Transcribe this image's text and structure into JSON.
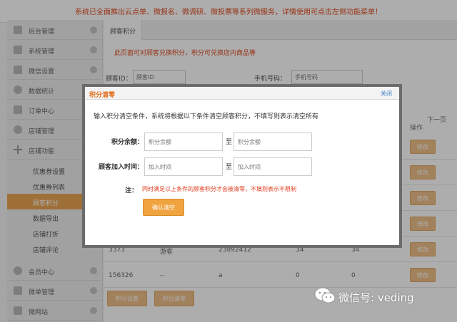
{
  "top_notice": "系统已全面推出云点单、微报名、微调研、微投票等系列微服务，详情使用可点击左侧功能菜单！",
  "sidebar": {
    "items": [
      {
        "label": "后台管理"
      },
      {
        "label": "系统管理"
      },
      {
        "label": "微信设置"
      },
      {
        "label": "数据统计"
      },
      {
        "label": "订单中心"
      },
      {
        "label": "店铺管理"
      },
      {
        "label": "店铺功能"
      }
    ],
    "subitems": [
      {
        "label": "优惠券设置"
      },
      {
        "label": "优惠券列表"
      },
      {
        "label": "顾客积分"
      },
      {
        "label": "数据导出"
      },
      {
        "label": "店铺打折"
      },
      {
        "label": "店铺评论"
      }
    ],
    "bottom_items": [
      {
        "label": "会员中心"
      },
      {
        "label": "微单管理"
      },
      {
        "label": "微网站"
      }
    ]
  },
  "main": {
    "tab_label": "顾客积分",
    "hint": "此页面可对顾客兑换积分，积分可兑换店内商品等",
    "filters": {
      "customer_id_label": "顾客ID：",
      "customer_id_placeholder": "顾客ID",
      "phone_label": "手机号码：",
      "phone_placeholder": "手机号码"
    },
    "next_label": "下一页",
    "col_operation": "操作",
    "edit_label": "修改",
    "rows": [
      {
        "id": "3373",
        "name": "游客",
        "phone": "23892412",
        "points": "34",
        "extra": "34"
      },
      {
        "id": "156326",
        "name": "--",
        "phone": "a",
        "points": "0",
        "extra": "0"
      }
    ],
    "bottom_buttons": {
      "set_points": "积分设置",
      "clear_points": "积分清零"
    }
  },
  "dialog": {
    "title": "积分清零",
    "close_label": "关闭",
    "description": "输入积分清空条件，系统将根据以下条件清空顾客积分，不填写则表示清空所有",
    "balance_label": "积分余额：",
    "balance_from_placeholder": "积分余额",
    "balance_to_placeholder": "积分余额",
    "join_time_label": "顾客加入时间：",
    "join_from_placeholder": "加入时间",
    "join_to_placeholder": "加入时间",
    "separator": "至",
    "note_label": "注：",
    "note_text": "同时满足以上条件的顾客积分才会被清零，不填则表示不限制",
    "confirm_label": "确认清空"
  },
  "watermark": {
    "text": "微信号: veding",
    "icon": "wechat-icon"
  },
  "colors": {
    "accent_orange": "#f0a440",
    "warning_red": "#e03b1e",
    "link_blue": "#3b7fc4"
  }
}
